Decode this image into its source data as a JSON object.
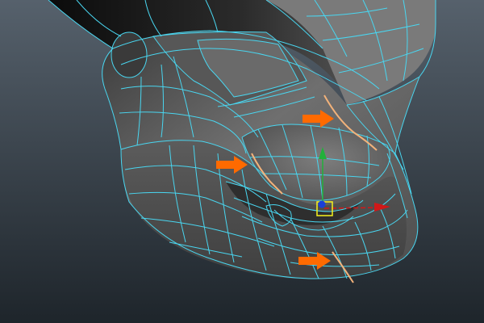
{
  "viewport": {
    "background_top": "#56616c",
    "background_bottom": "#1e252b"
  },
  "model": {
    "dark_shade": "#151515",
    "mid_shade": "#6e6e6e",
    "light_shade": "#7b7b7b",
    "wireframe_color": "#49d6f0",
    "selected_edge_color": "#f2b27a"
  },
  "annotations": {
    "arrow_color": "#ff6a00",
    "arrow_count": 3
  },
  "manipulator": {
    "x_axis_color": "#d01818",
    "y_axis_color": "#22b13a",
    "z_axis_color": "#1a3fd8",
    "pivot_color": "#f7f21c"
  }
}
